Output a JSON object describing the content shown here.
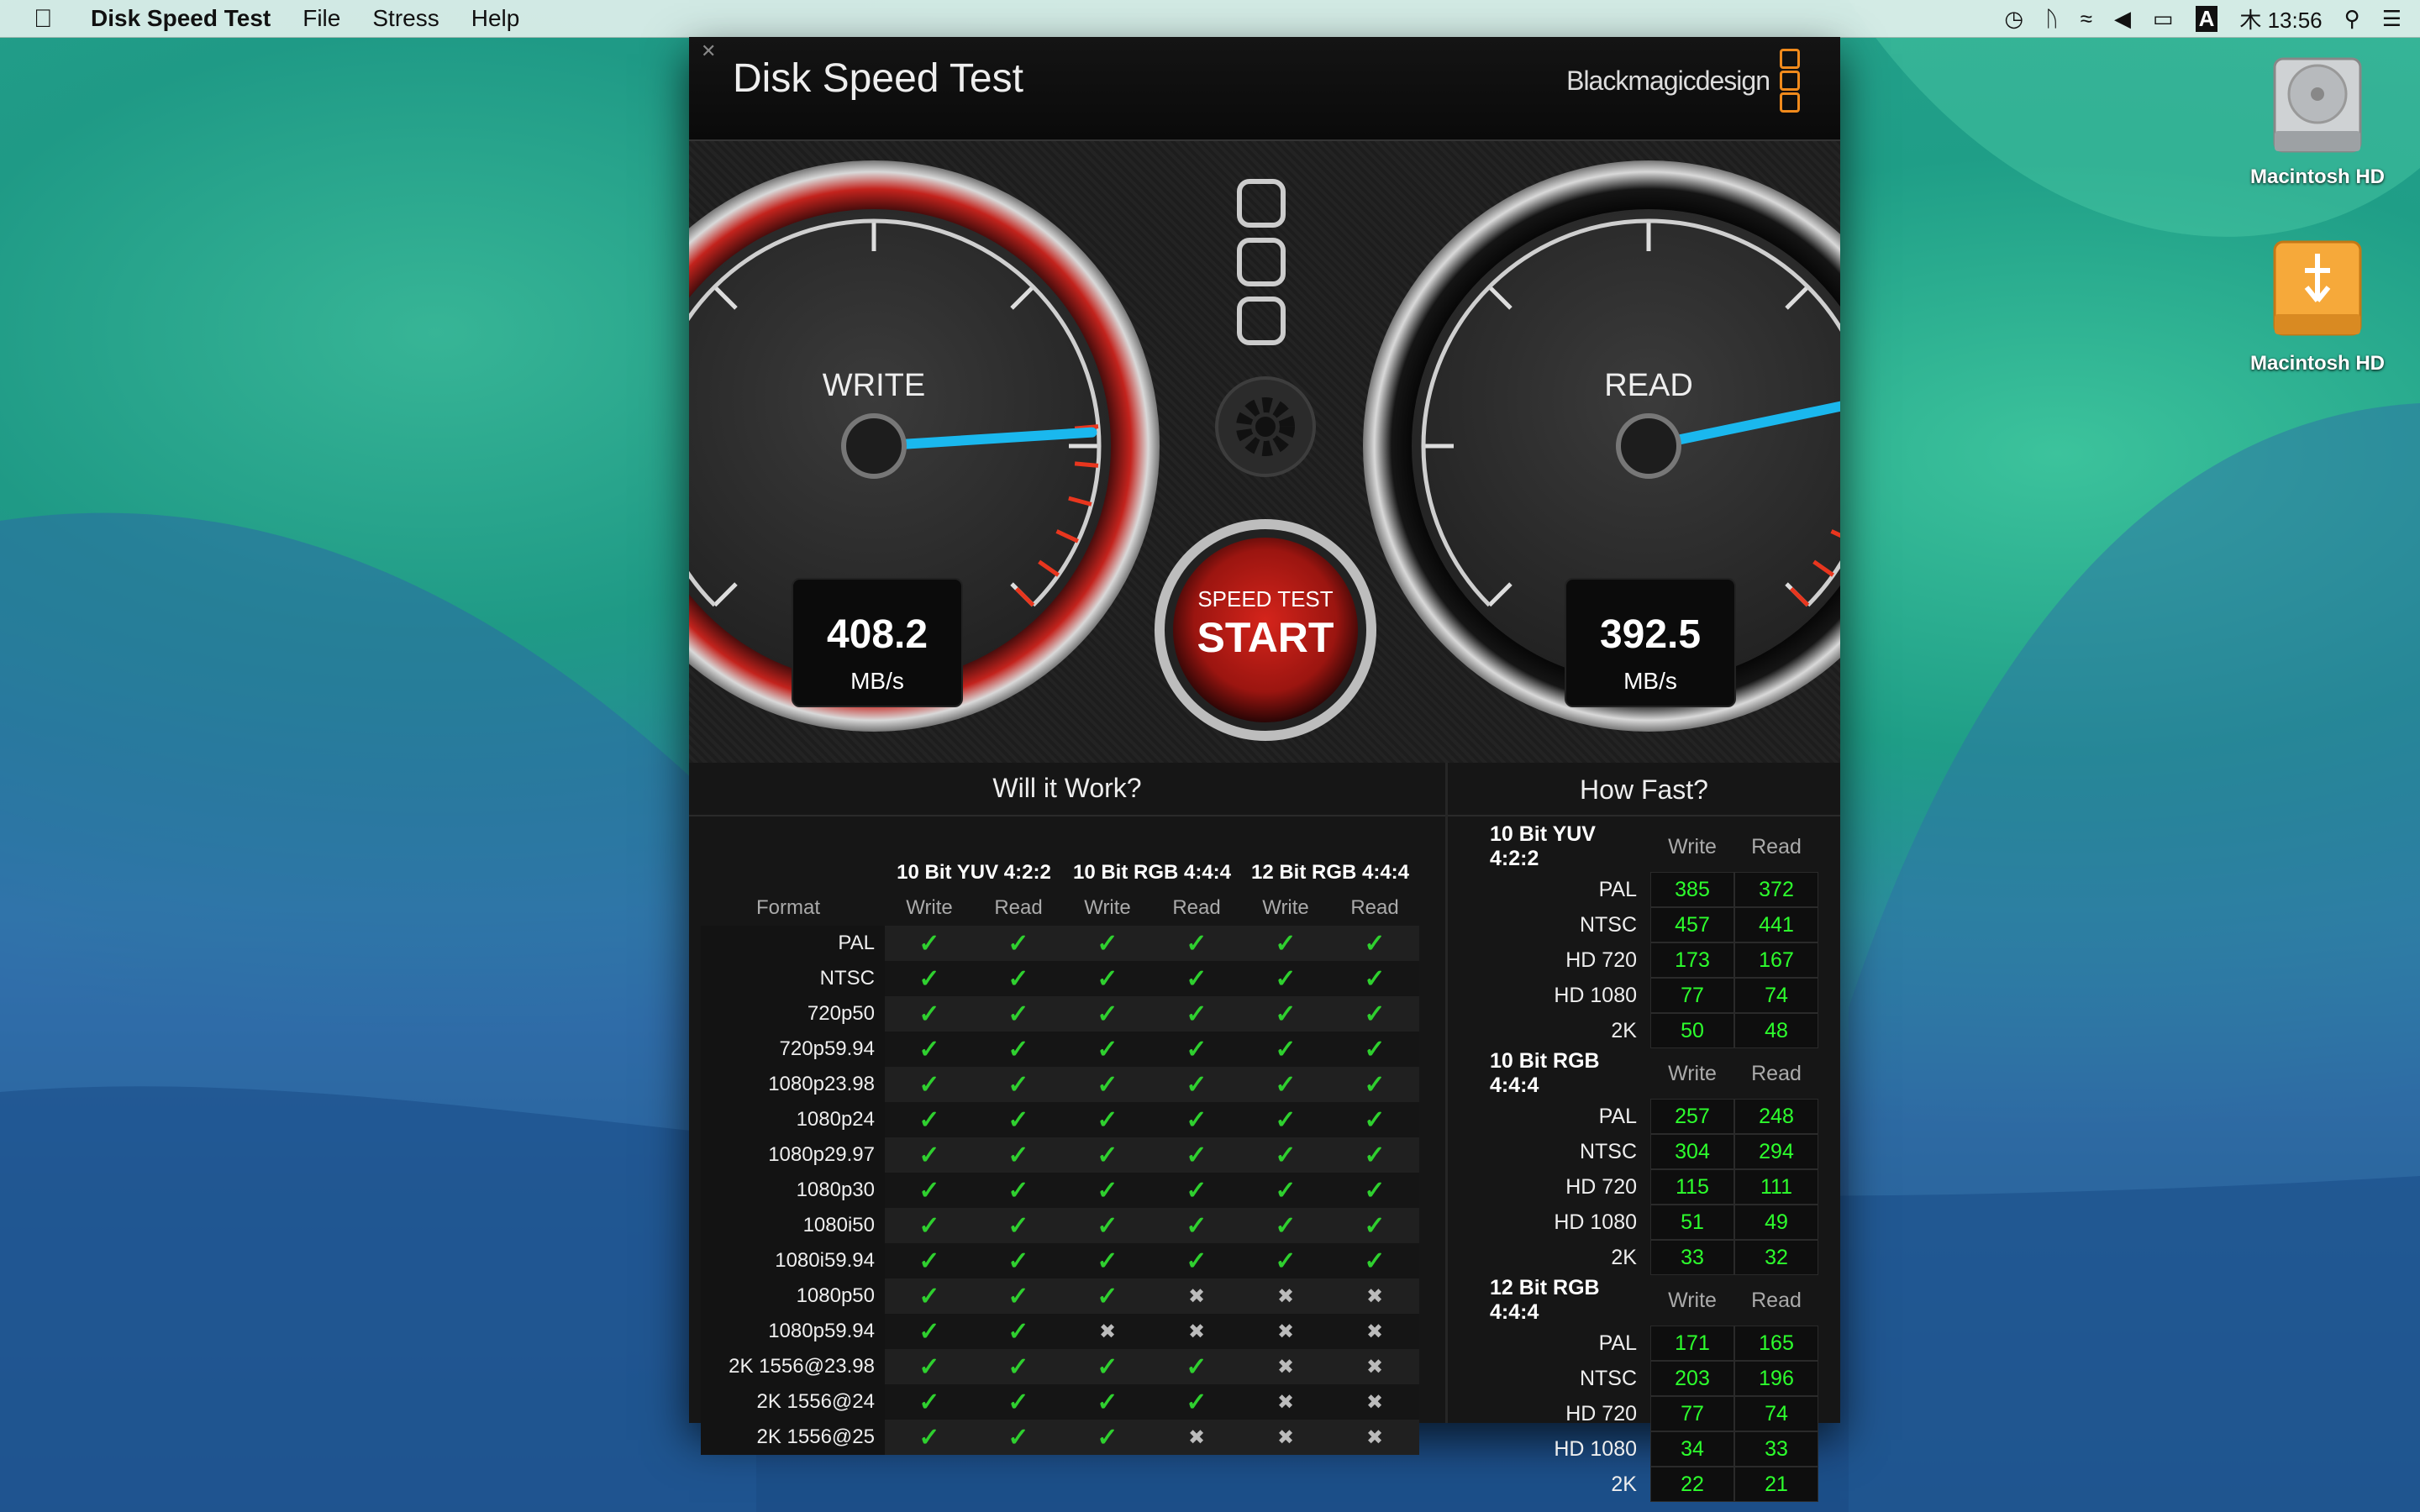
{
  "menubar": {
    "app_name": "Disk Speed Test",
    "menus": [
      "File",
      "Stress",
      "Help"
    ],
    "clock": "木 13:56",
    "input_icon": "A"
  },
  "desktop": {
    "icons": [
      {
        "label": "Macintosh HD",
        "icon": "hard-drive-icon"
      },
      {
        "label": "Macintosh HD",
        "icon": "usb-drive-icon"
      }
    ]
  },
  "window": {
    "title": "Disk Speed Test",
    "brand": "Blackmagicdesign"
  },
  "gauges": {
    "write": {
      "label": "WRITE",
      "value": "408.2",
      "unit": "MB/s",
      "max": "500",
      "needle_fraction": 0.82
    },
    "read": {
      "label": "READ",
      "value": "392.5",
      "unit": "MB/s",
      "max": "500",
      "needle_fraction": 0.79
    }
  },
  "start_button": {
    "caption": "SPEED TEST",
    "label": "START"
  },
  "will_it_work": {
    "title": "Will it Work?",
    "groups": [
      "10 Bit YUV 4:2:2",
      "10 Bit RGB 4:4:4",
      "12 Bit RGB 4:4:4"
    ],
    "format_header": "Format",
    "sub_headers": [
      "Write",
      "Read",
      "Write",
      "Read",
      "Write",
      "Read"
    ],
    "rows": [
      {
        "format": "PAL",
        "ok": [
          1,
          1,
          1,
          1,
          1,
          1
        ]
      },
      {
        "format": "NTSC",
        "ok": [
          1,
          1,
          1,
          1,
          1,
          1
        ]
      },
      {
        "format": "720p50",
        "ok": [
          1,
          1,
          1,
          1,
          1,
          1
        ]
      },
      {
        "format": "720p59.94",
        "ok": [
          1,
          1,
          1,
          1,
          1,
          1
        ]
      },
      {
        "format": "1080p23.98",
        "ok": [
          1,
          1,
          1,
          1,
          1,
          1
        ]
      },
      {
        "format": "1080p24",
        "ok": [
          1,
          1,
          1,
          1,
          1,
          1
        ]
      },
      {
        "format": "1080p29.97",
        "ok": [
          1,
          1,
          1,
          1,
          1,
          1
        ]
      },
      {
        "format": "1080p30",
        "ok": [
          1,
          1,
          1,
          1,
          1,
          1
        ]
      },
      {
        "format": "1080i50",
        "ok": [
          1,
          1,
          1,
          1,
          1,
          1
        ]
      },
      {
        "format": "1080i59.94",
        "ok": [
          1,
          1,
          1,
          1,
          1,
          1
        ]
      },
      {
        "format": "1080p50",
        "ok": [
          1,
          1,
          1,
          0,
          0,
          0
        ]
      },
      {
        "format": "1080p59.94",
        "ok": [
          1,
          1,
          0,
          0,
          0,
          0
        ]
      },
      {
        "format": "2K 1556@23.98",
        "ok": [
          1,
          1,
          1,
          1,
          0,
          0
        ]
      },
      {
        "format": "2K 1556@24",
        "ok": [
          1,
          1,
          1,
          1,
          0,
          0
        ]
      },
      {
        "format": "2K 1556@25",
        "ok": [
          1,
          1,
          1,
          0,
          0,
          0
        ]
      }
    ]
  },
  "how_fast": {
    "title": "How Fast?",
    "write_header": "Write",
    "read_header": "Read",
    "sections": [
      {
        "name": "10 Bit YUV 4:2:2",
        "rows": [
          {
            "label": "PAL",
            "write": "385",
            "read": "372"
          },
          {
            "label": "NTSC",
            "write": "457",
            "read": "441"
          },
          {
            "label": "HD 720",
            "write": "173",
            "read": "167"
          },
          {
            "label": "HD 1080",
            "write": "77",
            "read": "74"
          },
          {
            "label": "2K",
            "write": "50",
            "read": "48"
          }
        ]
      },
      {
        "name": "10 Bit RGB 4:4:4",
        "rows": [
          {
            "label": "PAL",
            "write": "257",
            "read": "248"
          },
          {
            "label": "NTSC",
            "write": "304",
            "read": "294"
          },
          {
            "label": "HD 720",
            "write": "115",
            "read": "111"
          },
          {
            "label": "HD 1080",
            "write": "51",
            "read": "49"
          },
          {
            "label": "2K",
            "write": "33",
            "read": "32"
          }
        ]
      },
      {
        "name": "12 Bit RGB 4:4:4",
        "rows": [
          {
            "label": "PAL",
            "write": "171",
            "read": "165"
          },
          {
            "label": "NTSC",
            "write": "203",
            "read": "196"
          },
          {
            "label": "HD 720",
            "write": "77",
            "read": "74"
          },
          {
            "label": "HD 1080",
            "write": "34",
            "read": "33"
          },
          {
            "label": "2K",
            "write": "22",
            "read": "21"
          }
        ]
      }
    ]
  }
}
